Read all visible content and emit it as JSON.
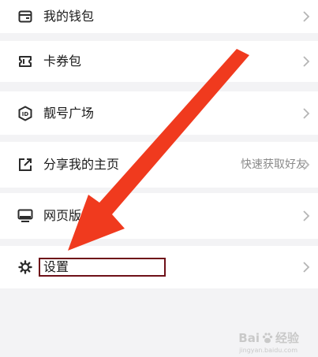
{
  "menu": {
    "wallet": {
      "label": "我的钱包",
      "icon": "wallet-icon"
    },
    "coupons": {
      "label": "卡券包",
      "icon": "ticket-icon"
    },
    "vanity_id": {
      "label": "靓号广场",
      "icon": "id-badge-icon"
    },
    "share": {
      "label": "分享我的主页",
      "hint": "快速获取好友",
      "icon": "share-icon"
    },
    "web": {
      "label": "网页版",
      "icon": "monitor-icon"
    },
    "settings": {
      "label": "设置",
      "icon": "gear-icon"
    }
  },
  "watermark": {
    "brand_left": "Bai",
    "brand_right": "经验",
    "sub": "jingyan.baidu.com"
  },
  "colors": {
    "arrow": "#f03a1e",
    "highlight": "#6e1018",
    "chevron": "#b5b5b5",
    "icon": "#2b2b2b"
  }
}
